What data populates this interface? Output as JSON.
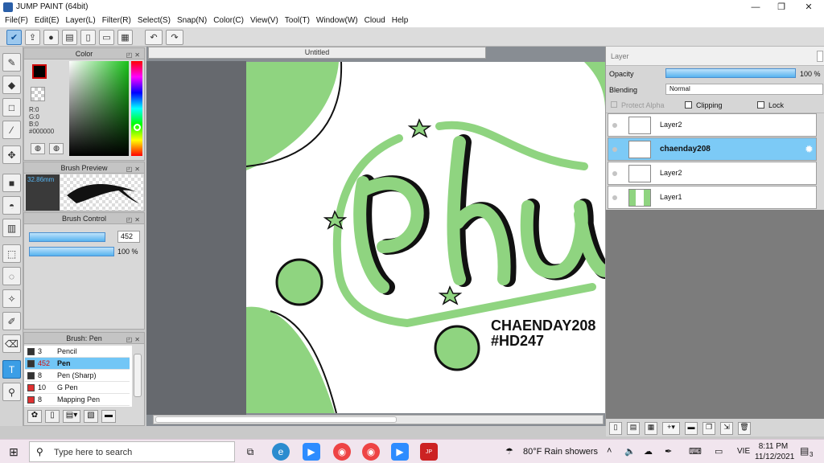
{
  "app": {
    "title": "JUMP PAINT (64bit)"
  },
  "menu": [
    "File(F)",
    "Edit(E)",
    "Layer(L)",
    "Filter(R)",
    "Select(S)",
    "Snap(N)",
    "Color(C)",
    "View(V)",
    "Tool(T)",
    "Window(W)",
    "Cloud",
    "Help"
  ],
  "color_panel": {
    "title": "Color",
    "r_label": "R:0",
    "g_label": "G:0",
    "b_label": "B:0",
    "hex": "#000000",
    "fg_color": "#000000",
    "bg_color": "#ffffff"
  },
  "brush_preview": {
    "title": "Brush Preview",
    "size_label": "32.86mm"
  },
  "brush_control": {
    "title": "Brush Control",
    "size_value": "452",
    "size_fraction": 0.9,
    "opacity_value": "100 %",
    "opacity_fraction": 1.0
  },
  "brush_list": {
    "title": "Brush: Pen",
    "items": [
      {
        "size": "3",
        "name": "Pencil",
        "color": "#333333"
      },
      {
        "size": "452",
        "name": "Pen",
        "color": "#333333",
        "selected": true
      },
      {
        "size": "8",
        "name": "Pen (Sharp)",
        "color": "#333333"
      },
      {
        "size": "10",
        "name": "G Pen",
        "color": "#e03030"
      },
      {
        "size": "8",
        "name": "Mapping Pen",
        "color": "#e03030"
      }
    ]
  },
  "document": {
    "tab_title": "Untitled",
    "canvas_text_line1": "CHAENDAY208",
    "canvas_text_line2": "#HD247"
  },
  "layer_panel": {
    "title": "Layer",
    "opacity_label": "Opacity",
    "opacity_value": "100 %",
    "opacity_fraction": 1.0,
    "blending_label": "Blending",
    "blending_value": "Normal",
    "protect_alpha_label": "Protect Alpha",
    "clipping_label": "Clipping",
    "lock_label": "Lock",
    "layers": [
      {
        "name": "Layer2",
        "selected": false
      },
      {
        "name": "chaenday208",
        "selected": true
      },
      {
        "name": "Layer2",
        "selected": false
      },
      {
        "name": "Layer1",
        "selected": false
      }
    ]
  },
  "taskbar": {
    "search_placeholder": "Type here to search",
    "weather": "80°F  Rain showers",
    "language": "VIE",
    "time": "8:11 PM",
    "date": "11/12/2021",
    "notification_count": "3"
  },
  "colors": {
    "accent": "#3b9ee6",
    "canvas_green": "#8fd480",
    "selection": "#72c6f6"
  }
}
